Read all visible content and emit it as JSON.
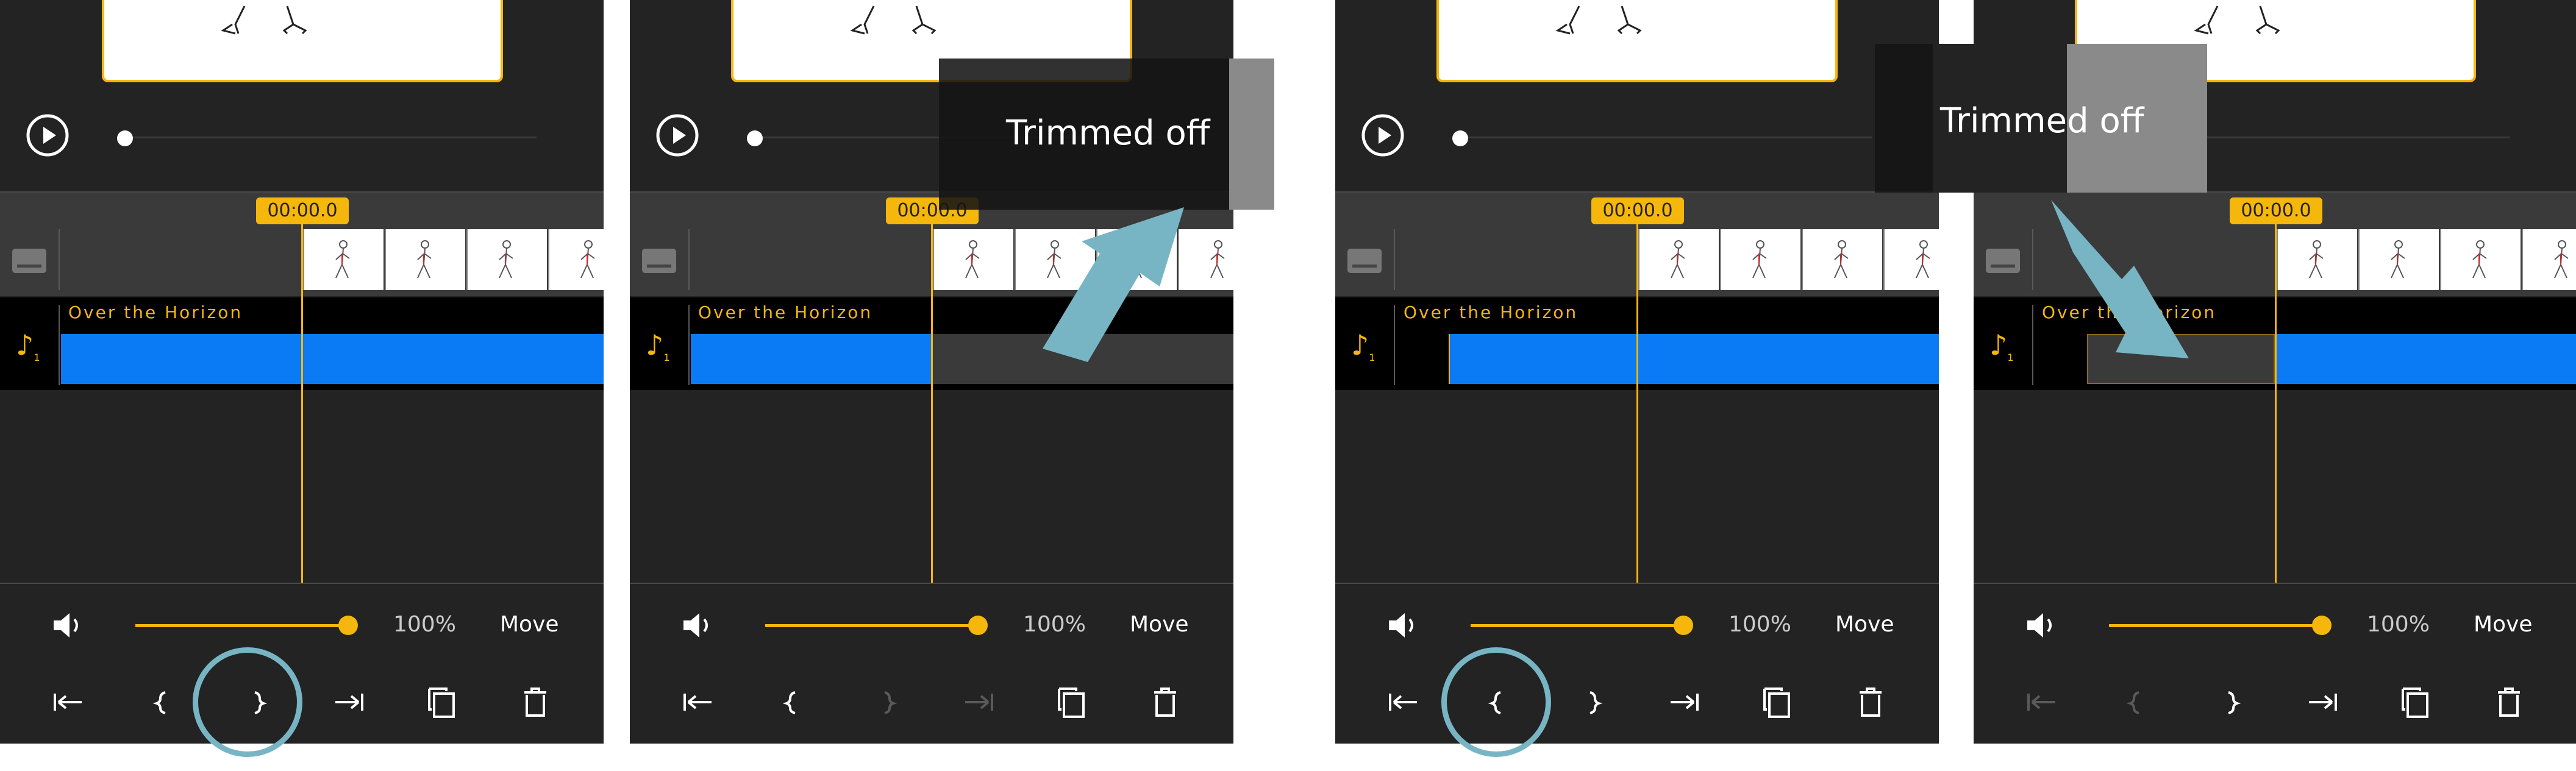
{
  "timestamp": "00:00.0",
  "audio_clip_title": "Over the Horizon",
  "audio_track_number": "1",
  "volume_percent": "100%",
  "volume_level": 1.0,
  "move_label": "Move",
  "callout_text": "Trimmed off",
  "icons": {
    "play": "play-circle-icon",
    "volume": "speaker-icon",
    "jump_start": "jump-to-start-icon",
    "trim_start": "trim-start-bracket-icon",
    "trim_end": "trim-end-bracket-icon",
    "jump_end": "jump-to-end-icon",
    "duplicate": "duplicate-icon",
    "delete": "trash-icon"
  },
  "colors": {
    "accent": "#f5b70c",
    "audio_waveform": "#0a7af5",
    "highlight_circle": "#78b5c4",
    "panel_bg": "#232323"
  }
}
